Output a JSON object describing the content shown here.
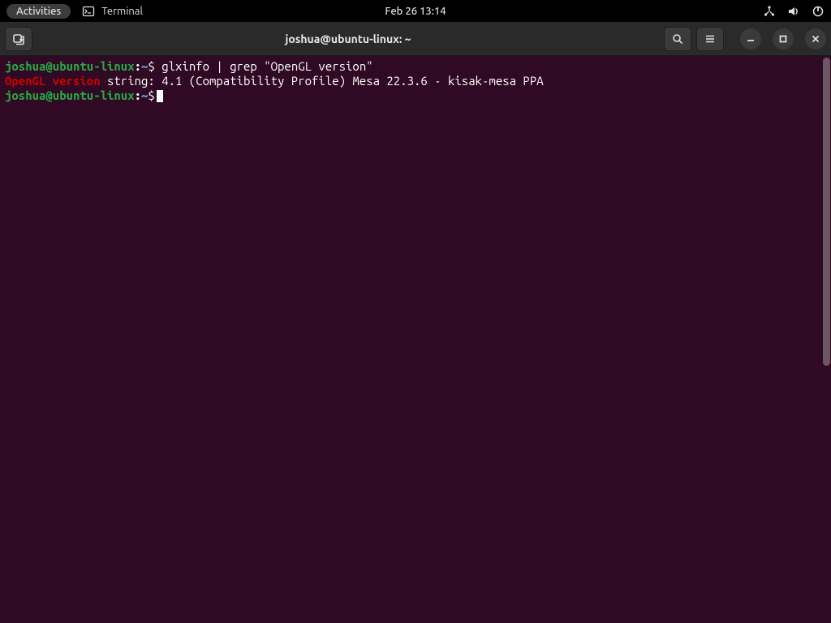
{
  "topbar": {
    "activities": "Activities",
    "app_name": "Terminal",
    "clock": "Feb 26  13:14"
  },
  "window": {
    "title": "joshua@ubuntu-linux: ~"
  },
  "terminal": {
    "prompt": {
      "user_host": "joshua@ubuntu-linux",
      "separator": ":",
      "path": "~",
      "symbol": "$"
    },
    "lines": [
      {
        "command": " glxinfo | grep \"OpenGL version\""
      },
      {
        "highlight": "OpenGL version",
        "rest": " string: 4.1 (Compatibility Profile) Mesa 22.3.6 - kisak-mesa PPA"
      }
    ]
  },
  "colors": {
    "terminal_bg": "#300a24",
    "prompt_user": "#28a745",
    "prompt_path": "#6a9fd4",
    "grep_match": "#cc0000"
  }
}
